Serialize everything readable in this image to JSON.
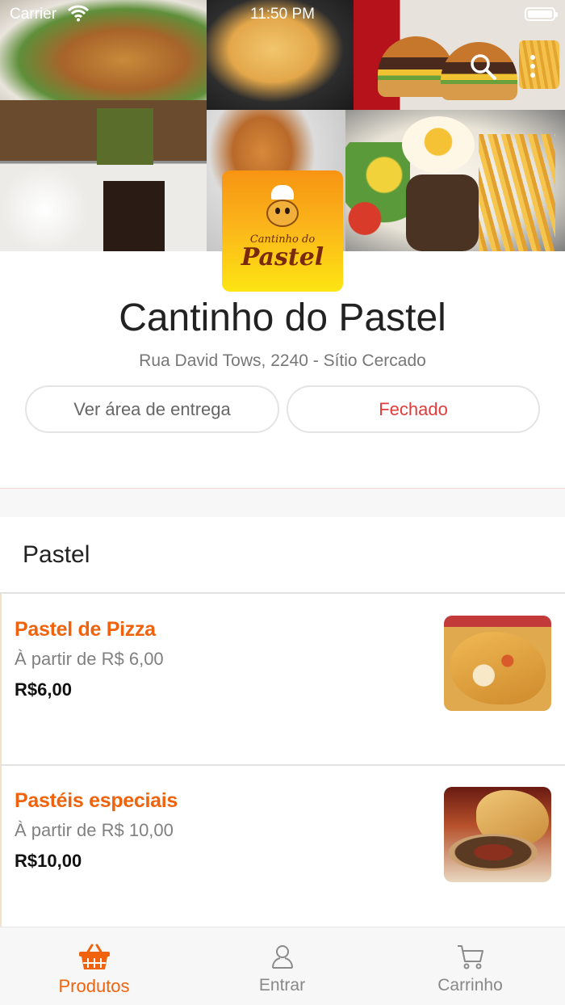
{
  "status_bar": {
    "carrier": "Carrier",
    "time": "11:50 PM"
  },
  "store": {
    "logo_small": "Cantinho do",
    "logo_big": "Pastel",
    "name": "Cantinho do Pastel",
    "address": "Rua David Tows, 2240 - Sítio Cercado",
    "delivery_area_label": "Ver área de entrega",
    "status_label": "Fechado"
  },
  "colors": {
    "accent": "#f0620c",
    "closed": "#e23b3b"
  },
  "section": {
    "title": "Pastel"
  },
  "products": [
    {
      "name": "Pastel de Pizza",
      "from_price": "À partir de R$ 6,00",
      "price": "R$6,00"
    },
    {
      "name": "Pastéis especiais",
      "from_price": "À partir de R$ 10,00",
      "price": "R$10,00"
    }
  ],
  "tabs": [
    {
      "label": "Produtos",
      "icon": "basket-icon",
      "active": true
    },
    {
      "label": "Entrar",
      "icon": "user-icon",
      "active": false
    },
    {
      "label": "Carrinho",
      "icon": "cart-icon",
      "active": false
    }
  ]
}
